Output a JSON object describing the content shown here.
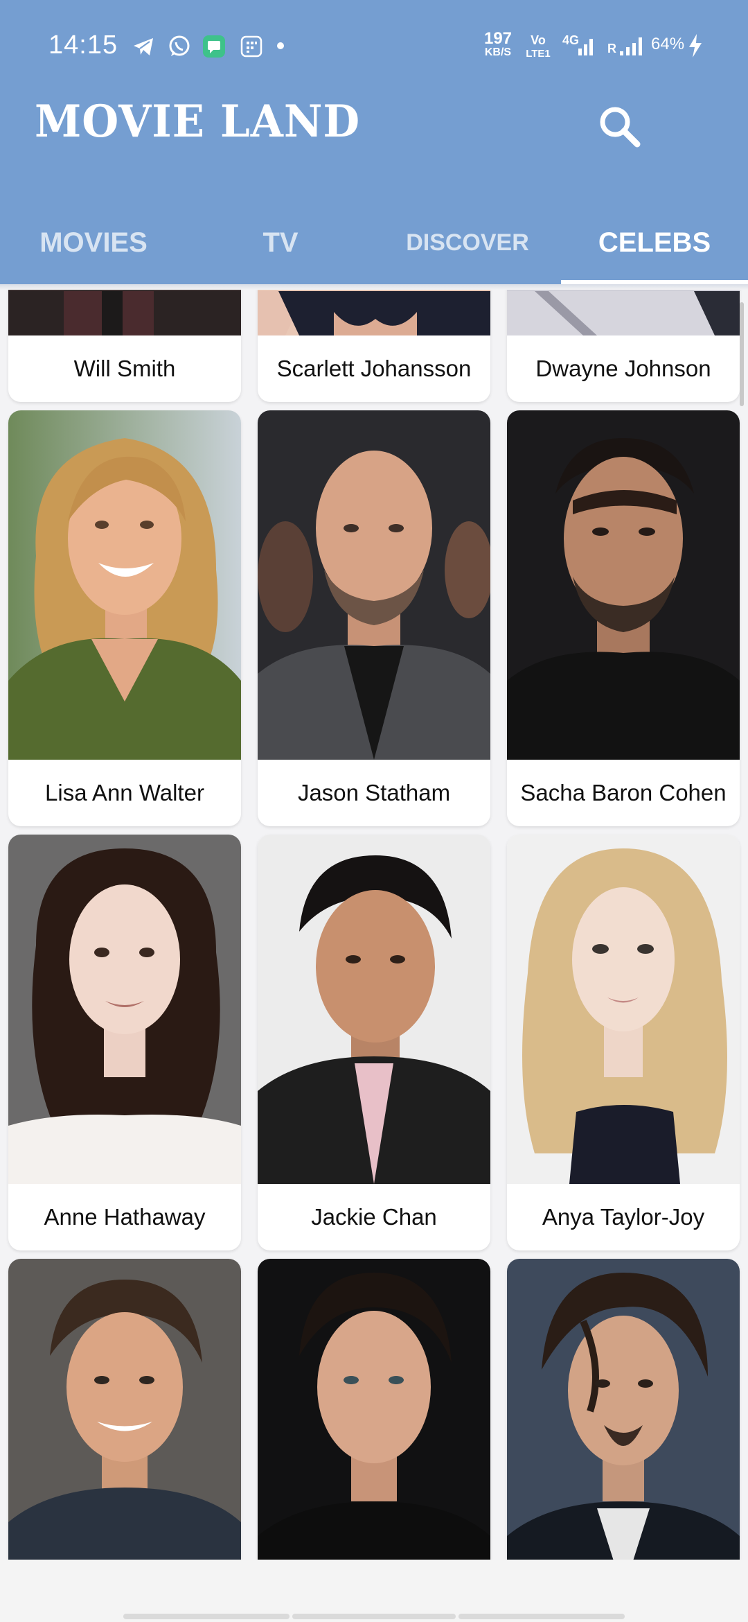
{
  "status_bar": {
    "time": "14:15",
    "net_speed_value": "197",
    "net_speed_unit": "KB/S",
    "volte_top": "Vo",
    "volte_bottom": "LTE1",
    "signal_label": "4G",
    "roaming": "R",
    "battery": "64%",
    "icons": [
      "telegram-icon",
      "whatsapp-icon",
      "messages-icon",
      "sim-toolkit-icon",
      "dot-icon",
      "signal-icon",
      "charging-icon"
    ]
  },
  "app": {
    "title": "MOVIE LAND",
    "search_icon": "search-icon"
  },
  "tabs": [
    {
      "label": "MOVIES",
      "active": false
    },
    {
      "label": "TV",
      "active": false
    },
    {
      "label": "DISCOVER",
      "active": false
    },
    {
      "label": "CELEBS",
      "active": true
    }
  ],
  "celebs": [
    {
      "name": "Will Smith"
    },
    {
      "name": "Scarlett Johansson"
    },
    {
      "name": "Dwayne Johnson"
    },
    {
      "name": "Lisa Ann Walter"
    },
    {
      "name": "Jason Statham"
    },
    {
      "name": "Sacha Baron Cohen"
    },
    {
      "name": "Anne Hathaway"
    },
    {
      "name": "Jackie Chan"
    },
    {
      "name": "Anya Taylor-Joy"
    },
    {
      "name": ""
    },
    {
      "name": ""
    },
    {
      "name": ""
    }
  ],
  "colors": {
    "app_bar": "#759ed1",
    "background": "#f3f3f5",
    "card": "#ffffff"
  }
}
